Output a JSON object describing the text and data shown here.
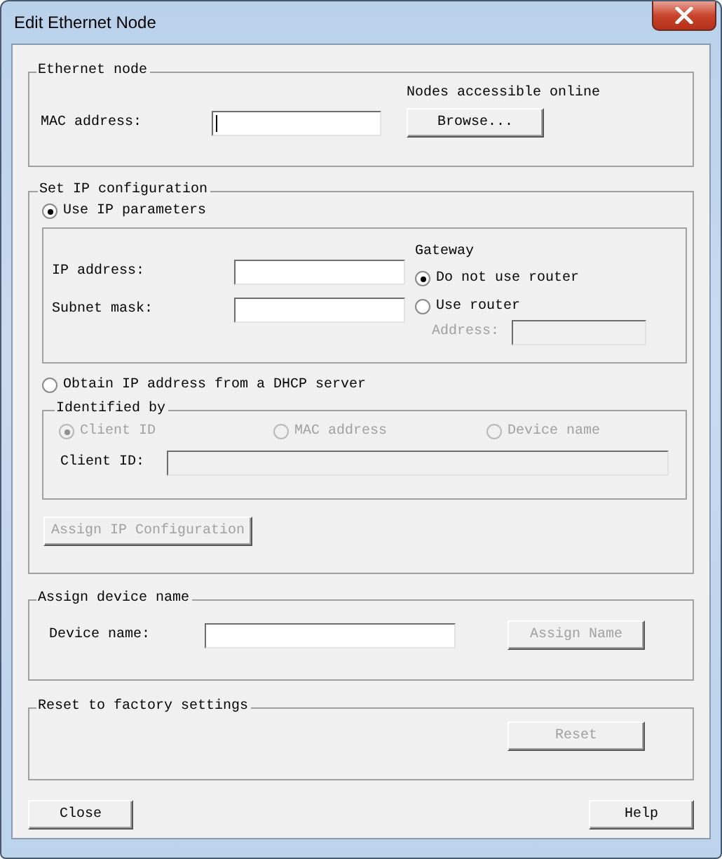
{
  "window": {
    "title": "Edit Ethernet Node"
  },
  "ethernet_node": {
    "legend": "Ethernet node",
    "browse_caption": "Nodes accessible online",
    "mac_label": "MAC address:",
    "mac_field": {
      "focused": true
    },
    "browse_button": {
      "label": "Browse...",
      "disabled": false
    }
  },
  "ip_configuration": {
    "legend": "Set IP configuration",
    "use_ip": {
      "label": "Use IP parameters",
      "selected": true
    },
    "ip_address_label": "IP address:",
    "subnet_mask_label": "Subnet mask:",
    "gateway": {
      "heading": "Gateway",
      "options": [
        {
          "label": "Do not use router",
          "selected": true
        },
        {
          "label": "Use router",
          "selected": false
        }
      ],
      "address_label": "Address:",
      "address_disabled": true
    },
    "dhcp": {
      "label": "Obtain IP address from a DHCP server",
      "selected": false
    },
    "identified_by": {
      "legend": "Identified by",
      "options": [
        {
          "label": "Client ID",
          "selected": true,
          "disabled": true
        },
        {
          "label": "MAC address",
          "selected": false,
          "disabled": true
        },
        {
          "label": "Device name",
          "selected": false,
          "disabled": true
        }
      ],
      "client_id_label": "Client ID:",
      "client_id_disabled": true
    },
    "assign_button": {
      "label": "Assign IP Configuration",
      "disabled": true
    }
  },
  "device_name": {
    "legend": "Assign device name",
    "label": "Device name:",
    "assign_button": {
      "label": "Assign Name",
      "disabled": true
    }
  },
  "factory_reset": {
    "legend": "Reset to factory settings",
    "reset_button": {
      "label": "Reset",
      "disabled": true
    }
  },
  "footer_buttons": [
    {
      "label": "Close",
      "disabled": false
    },
    {
      "label": "Help",
      "disabled": false
    }
  ]
}
